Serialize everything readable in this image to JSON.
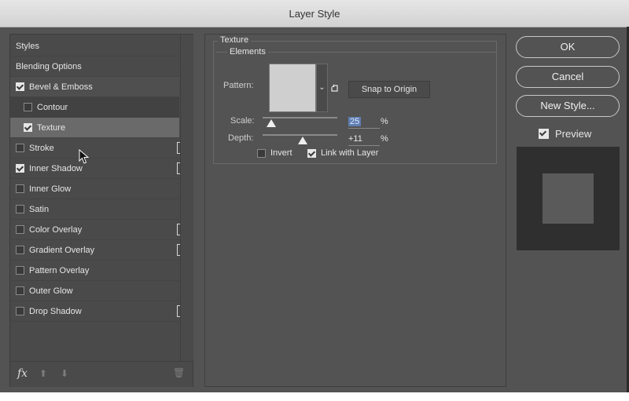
{
  "window": {
    "title": "Layer Style"
  },
  "sidebar": {
    "header": "Styles",
    "items": [
      {
        "label": "Blending Options"
      },
      {
        "label": "Bevel & Emboss",
        "checked": true
      },
      {
        "label": "Contour",
        "checked": false
      },
      {
        "label": "Texture",
        "checked": true
      },
      {
        "label": "Stroke",
        "checked": false,
        "add": true
      },
      {
        "label": "Inner Shadow",
        "checked": true,
        "add": true
      },
      {
        "label": "Inner Glow",
        "checked": false
      },
      {
        "label": "Satin",
        "checked": false
      },
      {
        "label": "Color Overlay",
        "checked": false,
        "add": true
      },
      {
        "label": "Gradient Overlay",
        "checked": false,
        "add": true
      },
      {
        "label": "Pattern Overlay",
        "checked": false
      },
      {
        "label": "Outer Glow",
        "checked": false
      },
      {
        "label": "Drop Shadow",
        "checked": false,
        "add": true
      }
    ],
    "footer": {
      "fx": "fx",
      "up": "⬆",
      "down": "⬇",
      "trash": "🗑"
    }
  },
  "texture": {
    "group_title": "Texture",
    "elements_title": "Elements",
    "pattern_label": "Pattern:",
    "snap_label": "Snap to Origin",
    "scale_label": "Scale:",
    "scale_value": "25",
    "scale_unit": "%",
    "depth_label": "Depth:",
    "depth_value": "+11",
    "depth_unit": "%",
    "invert_label": "Invert",
    "invert_checked": false,
    "link_label": "Link with Layer",
    "link_checked": true
  },
  "buttons": {
    "ok": "OK",
    "cancel": "Cancel",
    "new_style": "New Style...",
    "preview": "Preview",
    "preview_checked": true
  }
}
